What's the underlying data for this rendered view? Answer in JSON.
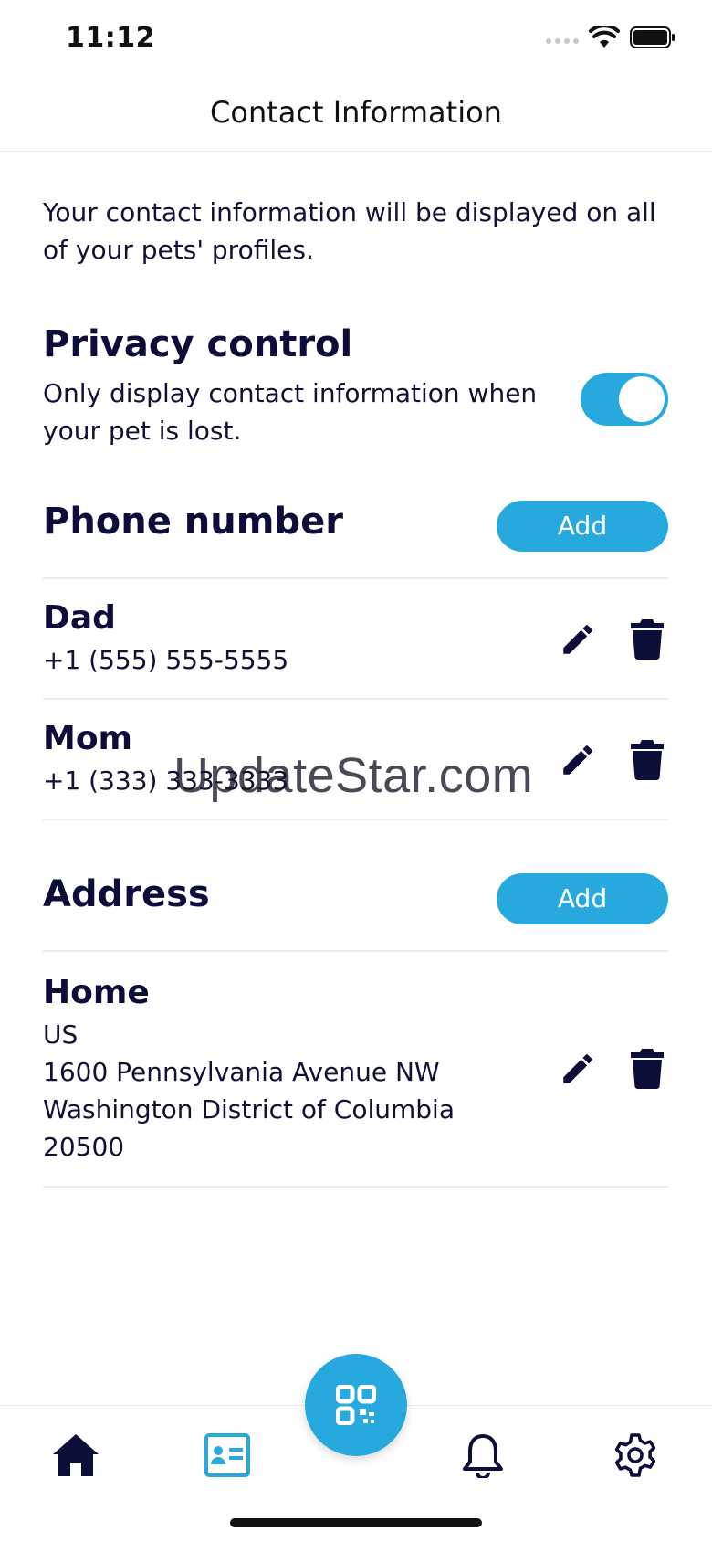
{
  "status_bar": {
    "time": "11:12"
  },
  "header": {
    "title": "Contact Information"
  },
  "intro_text": "Your contact information will be displayed on all of your pets' profiles.",
  "privacy": {
    "title": "Privacy control",
    "description": "Only display contact information when your pet is lost.",
    "toggle_on": true
  },
  "phone": {
    "title": "Phone number",
    "add_label": "Add",
    "entries": [
      {
        "label": "Dad",
        "value": "+1 (555) 555-5555"
      },
      {
        "label": "Mom",
        "value": "+1 (333) 333-3333"
      }
    ]
  },
  "address": {
    "title": "Address",
    "add_label": "Add",
    "entries": [
      {
        "label": "Home",
        "lines": [
          "US",
          "1600 Pennsylvania Avenue NW",
          "Washington District of Columbia",
          "20500"
        ]
      }
    ]
  },
  "watermark": "UpdateStar.com",
  "tabs": [
    {
      "icon": "home-icon"
    },
    {
      "icon": "contact-card-icon",
      "active": true
    },
    {
      "icon": "qr-code-icon"
    },
    {
      "icon": "bell-icon"
    },
    {
      "icon": "gear-icon"
    }
  ],
  "colors": {
    "accent": "#28a9de",
    "text_dark": "#0d0d3a"
  }
}
